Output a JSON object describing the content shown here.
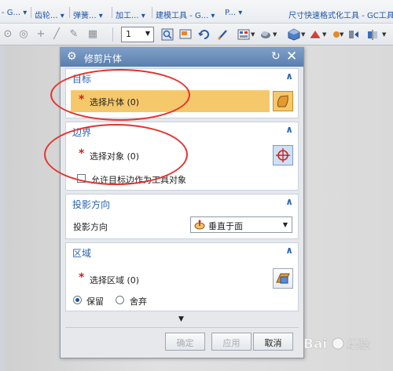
{
  "menubar": {
    "items": [
      "- G... ▾",
      "齿轮... ▾",
      "弹簧... ▾",
      "加工... ▾",
      "建模工具 - G... ▾",
      "P... ▾",
      "尺寸快速格式化工具 - GC工具"
    ]
  },
  "toolbar": {
    "layer_value": "1"
  },
  "dialog": {
    "title": "修剪片体",
    "target": {
      "header": "目标",
      "select_label": "选择片体 (0)"
    },
    "boundary": {
      "header": "边界",
      "select_label": "选择对象 (0)",
      "allow_label": "允许目标边作为工具对象"
    },
    "projection": {
      "header": "投影方向",
      "label": "投影方向",
      "value": "垂直于面"
    },
    "region": {
      "header": "区域",
      "select_label": "选择区域 (0)",
      "keep_label": "保留",
      "discard_label": "舍弃"
    },
    "buttons": {
      "ok": "确定",
      "apply": "应用",
      "cancel": "取消"
    }
  },
  "watermark": {
    "text": "Baidu 经验"
  },
  "colors": {
    "accent": "#2a64b0",
    "highlight": "#f5c86b",
    "annotation": "#e4332e"
  }
}
